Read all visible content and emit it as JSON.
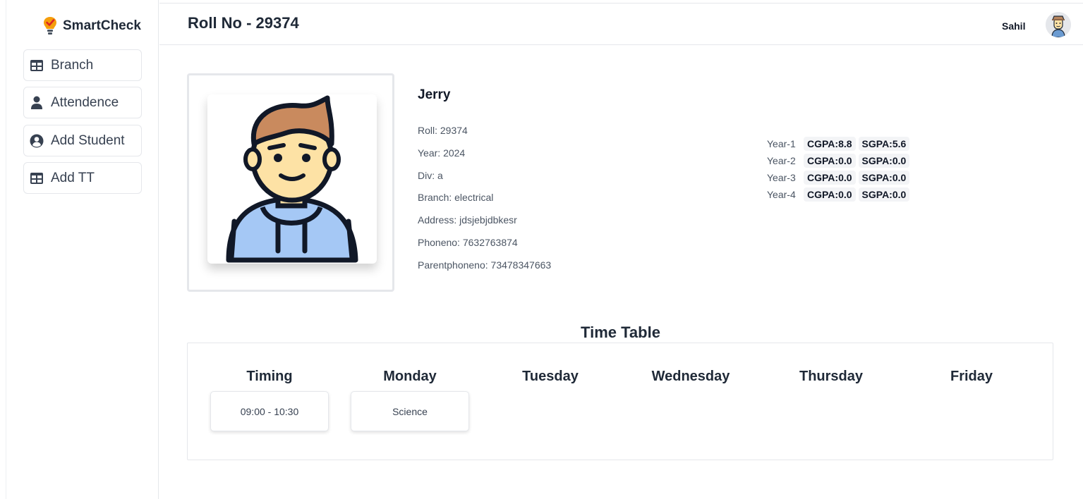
{
  "brand": {
    "name": "SmartCheck",
    "icon": "lightbulb-check-icon"
  },
  "sidebar": {
    "items": [
      {
        "label": "Branch",
        "icon": "table-icon"
      },
      {
        "label": "Attendence",
        "icon": "user-icon"
      },
      {
        "label": "Add Student",
        "icon": "user-circle-icon"
      },
      {
        "label": "Add TT",
        "icon": "table-icon"
      }
    ]
  },
  "header": {
    "title": "Roll No - 29374",
    "user_name": "Sahil"
  },
  "student": {
    "name": "Jerry",
    "roll": "Roll: 29374",
    "year": "Year: 2024",
    "div": "Div: a",
    "branch": "Branch: electrical",
    "address": "Address: jdsjebjdbkesr",
    "phone": "Phoneno: 7632763874",
    "parent_phone": "Parentphoneno: 73478347663"
  },
  "grades": [
    {
      "year": "Year-1",
      "cgpa": "CGPA:8.8",
      "sgpa": "SGPA:5.6"
    },
    {
      "year": "Year-2",
      "cgpa": "CGPA:0.0",
      "sgpa": "SGPA:0.0"
    },
    {
      "year": "Year-3",
      "cgpa": "CGPA:0.0",
      "sgpa": "SGPA:0.0"
    },
    {
      "year": "Year-4",
      "cgpa": "CGPA:0.0",
      "sgpa": "SGPA:0.0"
    }
  ],
  "timetable": {
    "title": "Time Table",
    "columns": [
      "Timing",
      "Monday",
      "Tuesday",
      "Wednesday",
      "Thursday",
      "Friday"
    ],
    "rows": [
      {
        "timing": "09:00 - 10:30",
        "monday": "Science"
      }
    ]
  },
  "colors": {
    "accent": "#f97316",
    "avatar_shirt": "#a5c8f5",
    "hair": "#c98a5e",
    "skin": "#fde2a5"
  }
}
